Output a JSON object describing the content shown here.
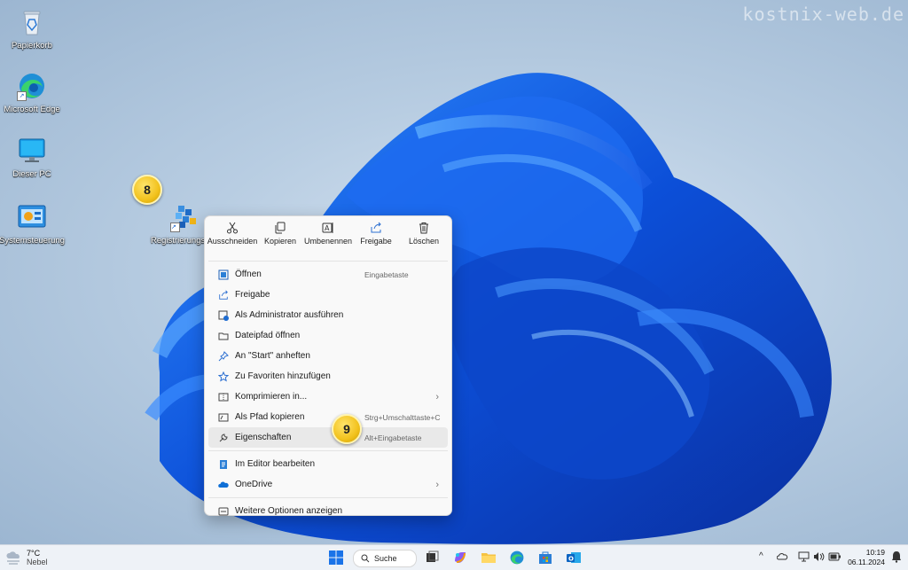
{
  "watermark": "kostnix-web.de",
  "desktop_icons": [
    {
      "label": "Papierkorb"
    },
    {
      "label": "Microsoft Edge"
    },
    {
      "label": "Dieser PC"
    },
    {
      "label": "Systemsteuerung"
    },
    {
      "label": "Registrierungse"
    }
  ],
  "badges": {
    "step8": "8",
    "step9": "9"
  },
  "context_menu": {
    "quick_actions": [
      {
        "label": "Ausschneiden",
        "icon": "scissors-icon"
      },
      {
        "label": "Kopieren",
        "icon": "copy-icon"
      },
      {
        "label": "Umbenennen",
        "icon": "rename-icon"
      },
      {
        "label": "Freigabe",
        "icon": "share-icon"
      },
      {
        "label": "Löschen",
        "icon": "trash-icon"
      }
    ],
    "items": [
      {
        "label": "Öffnen",
        "shortcut": "Eingabetaste"
      },
      {
        "label": "Freigabe"
      },
      {
        "label": "Als Administrator ausführen"
      },
      {
        "label": "Dateipfad öffnen"
      },
      {
        "label": "An \"Start\" anheften"
      },
      {
        "label": "Zu Favoriten hinzufügen"
      },
      {
        "label": "Komprimieren in..."
      },
      {
        "label": "Als Pfad kopieren",
        "shortcut": "Strg+Umschalttaste+C"
      },
      {
        "label": "Eigenschaften",
        "shortcut": "Alt+Eingabetaste"
      },
      {
        "label": "Im Editor bearbeiten"
      },
      {
        "label": "OneDrive"
      },
      {
        "label": "Weitere Optionen anzeigen"
      }
    ]
  },
  "taskbar": {
    "weather": {
      "temp": "7°C",
      "condition": "Nebel"
    },
    "search_label": "Suche",
    "clock": {
      "time": "10:19",
      "date": "06.11.2024"
    }
  }
}
